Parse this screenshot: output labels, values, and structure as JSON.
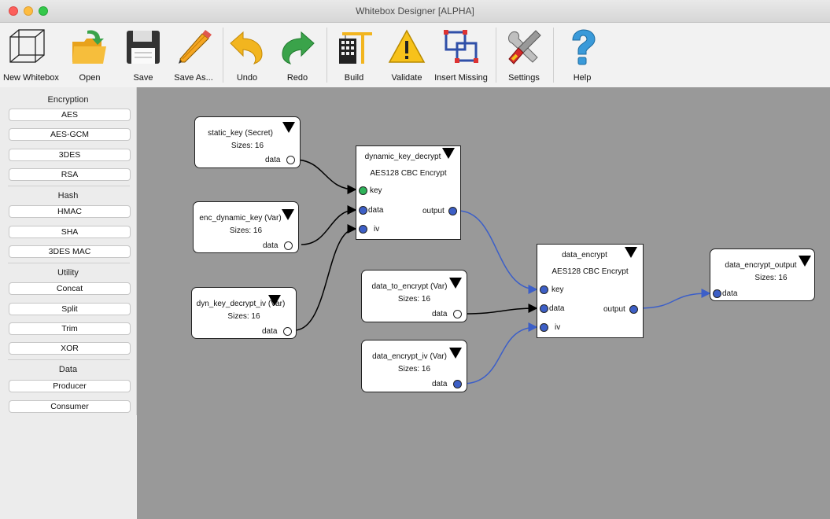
{
  "window": {
    "title": "Whitebox Designer [ALPHA]"
  },
  "toolbar": {
    "new": "New Whitebox",
    "open": "Open",
    "save": "Save",
    "save_as": "Save As...",
    "undo": "Undo",
    "redo": "Redo",
    "build": "Build",
    "validate": "Validate",
    "insert_missing": "Insert Missing",
    "settings": "Settings",
    "help": "Help"
  },
  "sidebar": {
    "encryption": {
      "header": "Encryption",
      "items": [
        "AES",
        "AES-GCM",
        "3DES",
        "RSA"
      ]
    },
    "hash": {
      "header": "Hash",
      "items": [
        "HMAC",
        "SHA",
        "3DES MAC"
      ]
    },
    "utility": {
      "header": "Utility",
      "items": [
        "Concat",
        "Split",
        "Trim",
        "XOR"
      ]
    },
    "data": {
      "header": "Data",
      "items": [
        "Producer",
        "Consumer"
      ]
    }
  },
  "nodes": {
    "static_key": {
      "title": "static_key (Secret)",
      "sizes": "Sizes: 16",
      "port": "data"
    },
    "enc_dynamic_key": {
      "title": "enc_dynamic_key (Var)",
      "sizes": "Sizes: 16",
      "port": "data"
    },
    "dyn_key_decrypt_iv": {
      "title": "dyn_key_decrypt_iv (Var)",
      "sizes": "Sizes: 16",
      "port": "data"
    },
    "dynamic_key_decrypt": {
      "title": "dynamic_key_decrypt",
      "subtitle": "AES128 CBC Encrypt",
      "key": "key",
      "data": "data",
      "iv": "iv",
      "output": "output"
    },
    "data_to_encrypt": {
      "title": "data_to_encrypt (Var)",
      "sizes": "Sizes: 16",
      "port": "data"
    },
    "data_encrypt_iv": {
      "title": "data_encrypt_iv (Var)",
      "sizes": "Sizes: 16",
      "port": "data"
    },
    "data_encrypt": {
      "title": "data_encrypt",
      "subtitle": "AES128 CBC Encrypt",
      "key": "key",
      "data": "data",
      "iv": "iv",
      "output": "output"
    },
    "data_encrypt_output": {
      "title": "data_encrypt_output",
      "sizes": "Sizes: 16",
      "port": "data"
    }
  },
  "colors": {
    "canvas": "#999999",
    "wire_black": "#000000",
    "wire_blue": "#3c5fc8",
    "port_blue": "#3d5fc6",
    "port_green": "#2fb35a"
  }
}
